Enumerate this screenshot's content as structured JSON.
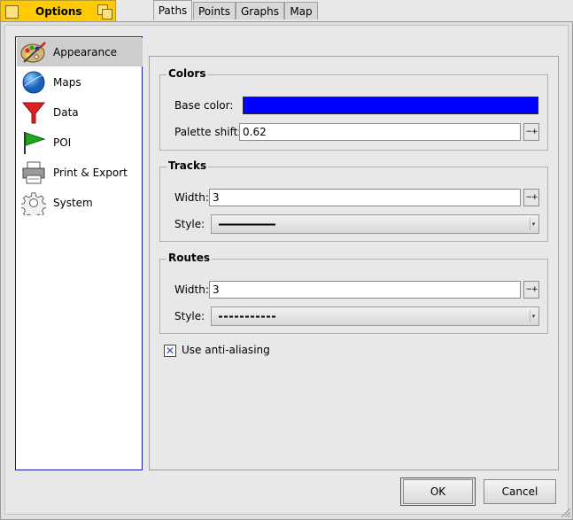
{
  "window": {
    "title": "Options"
  },
  "sidebar": {
    "items": [
      {
        "label": "Appearance",
        "icon": "palette-icon",
        "selected": true
      },
      {
        "label": "Maps",
        "icon": "globe-icon",
        "selected": false
      },
      {
        "label": "Data",
        "icon": "funnel-icon",
        "selected": false
      },
      {
        "label": "POI",
        "icon": "flag-icon",
        "selected": false
      },
      {
        "label": "Print & Export",
        "icon": "printer-icon",
        "selected": false
      },
      {
        "label": "System",
        "icon": "gear-icon",
        "selected": false
      }
    ]
  },
  "tabs": [
    {
      "label": "Paths",
      "active": true
    },
    {
      "label": "Points",
      "active": false
    },
    {
      "label": "Graphs",
      "active": false
    },
    {
      "label": "Map",
      "active": false
    }
  ],
  "colors_group": {
    "title": "Colors",
    "base_color_label": "Base color:",
    "base_color_value": "#0000ff",
    "palette_shift_label": "Palette shift:",
    "palette_shift_value": "0.62"
  },
  "tracks_group": {
    "title": "Tracks",
    "width_label": "Width:",
    "width_value": "3",
    "style_label": "Style:",
    "style_value": "solid"
  },
  "routes_group": {
    "title": "Routes",
    "width_label": "Width:",
    "width_value": "3",
    "style_label": "Style:",
    "style_value": "dashed"
  },
  "antialiasing": {
    "label": "Use anti-aliasing",
    "checked": true
  },
  "buttons": {
    "ok": "OK",
    "cancel": "Cancel"
  },
  "theme": {
    "title_tab": "#ffcb00",
    "selection_border": "#1a1aa8"
  }
}
